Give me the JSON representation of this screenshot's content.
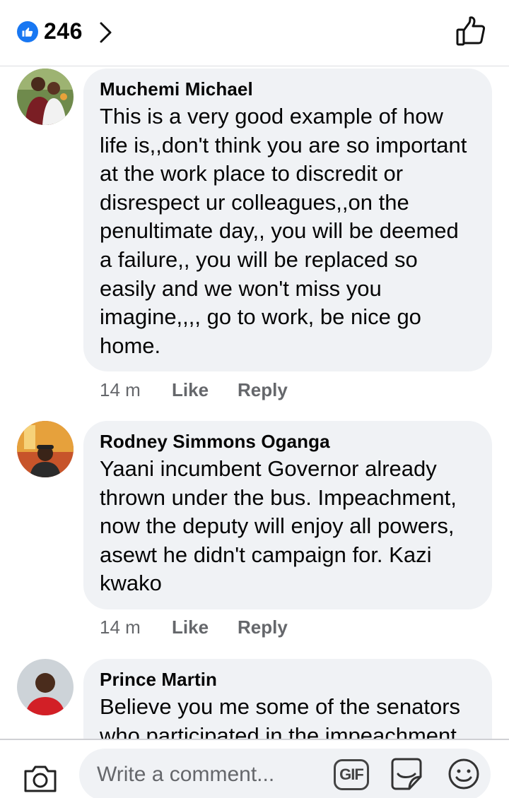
{
  "reactions": {
    "count": "246"
  },
  "comments": [
    {
      "author": "Muchemi Michael",
      "text": "This is a very good example of how life is,,don't think you are so important at the work place to discredit or disrespect ur colleagues,,on the penultimate day,, you will be deemed a failure,, you will be replaced so easily and we won't miss you imagine,,,, go to work, be nice go home.",
      "time": "14 m",
      "like": "Like",
      "reply": "Reply"
    },
    {
      "author": "Rodney Simmons Oganga",
      "text": "Yaani incumbent Governor already thrown under the bus. Impeachment, now the deputy will enjoy all powers, asewt he didn't campaign for. Kazi kwako",
      "time": "14 m",
      "like": "Like",
      "reply": "Reply"
    },
    {
      "author": "Prince Martin",
      "text": "Believe you me some of the senators who participated in the impeachment"
    }
  ],
  "composer": {
    "placeholder": "Write a comment...",
    "gif_label": "GIF"
  },
  "colors": {
    "accent": "#1877f2",
    "bubble": "#f0f2f5",
    "meta": "#65676b"
  }
}
